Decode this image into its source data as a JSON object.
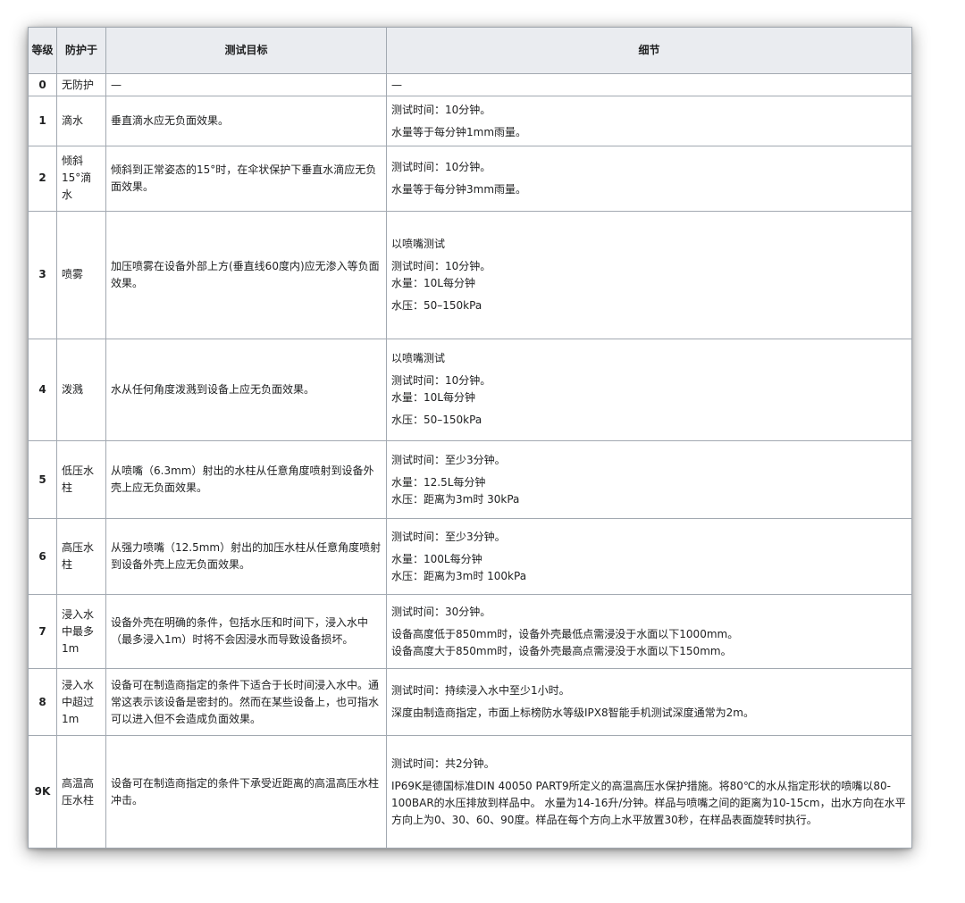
{
  "headers": {
    "level": "等级",
    "protect_against": "防护于",
    "test_goal": "测试目标",
    "details": "细节"
  },
  "rows": [
    {
      "level": "0",
      "protect": "无防护",
      "goal": "—",
      "details": [
        "—"
      ]
    },
    {
      "level": "1",
      "protect": "滴水",
      "goal": "垂直滴水应无负面效果。",
      "details": [
        "测试时间：10分钟。",
        "水量等于每分钟1mm雨量。"
      ]
    },
    {
      "level": "2",
      "protect": "倾斜15°滴水",
      "goal": "倾斜到正常姿态的15°时，在伞状保护下垂直水滴应无负面效果。",
      "details": [
        "测试时间：10分钟。",
        "水量等于每分钟3mm雨量。"
      ]
    },
    {
      "level": "3",
      "protect": "喷雾",
      "goal": "加压喷雾在设备外部上方(垂直线60度内)应无渗入等负面效果。",
      "details": [
        "以喷嘴测试",
        "测试时间：10分钟。",
        "水量：10L每分钟",
        "水压：50–150kPa"
      ]
    },
    {
      "level": "4",
      "protect": "泼溅",
      "goal": "水从任何角度泼溅到设备上应无负面效果。",
      "details": [
        "以喷嘴测试",
        "测试时间：10分钟。",
        "水量：10L每分钟",
        "水压：50–150kPa"
      ]
    },
    {
      "level": "5",
      "protect": "低压水柱",
      "goal": "从喷嘴（6.3mm）射出的水柱从任意角度喷射到设备外壳上应无负面效果。",
      "details": [
        "测试时间：至少3分钟。",
        "水量：12.5L每分钟",
        "水压：距离为3m时 30kPa"
      ]
    },
    {
      "level": "6",
      "protect": "高压水柱",
      "goal": "从强力喷嘴（12.5mm）射出的加压水柱从任意角度喷射到设备外壳上应无负面效果。",
      "details": [
        "测试时间：至少3分钟。",
        "水量：100L每分钟",
        "水压：距离为3m时 100kPa"
      ]
    },
    {
      "level": "7",
      "protect": "浸入水中最多1m",
      "goal": "设备外壳在明确的条件，包括水压和时间下，浸入水中（最多浸入1m）时将不会因浸水而导致设备损坏。",
      "details": [
        "测试时间：30分钟。",
        "设备高度低于850mm时，设备外壳最低点需浸没于水面以下1000mm。",
        "设备高度大于850mm时，设备外壳最高点需浸没于水面以下150mm。"
      ]
    },
    {
      "level": "8",
      "protect": "浸入水中超过1m",
      "goal": "设备可在制造商指定的条件下适合于长时间浸入水中。通常这表示该设备是密封的。然而在某些设备上，也可指水可以进入但不会造成负面效果。",
      "details": [
        "测试时间：持续浸入水中至少1小时。",
        "深度由制造商指定，市面上标榜防水等级IPX8智能手机测试深度通常为2m。"
      ]
    },
    {
      "level": "9K",
      "protect": "高温高压水柱",
      "goal": "设备可在制造商指定的条件下承受近距离的高温高压水柱冲击。",
      "details": [
        "测试时间：共2分钟。",
        "IP69K是德国标准DIN 40050 PART9所定义的高温高压水保护措施。将80℃的水从指定形状的喷嘴以80-100BAR的水压排放到样品中。 水量为14-16升/分钟。样品与喷嘴之间的距离为10-15cm，出水方向在水平方向上为0、30、60、90度。样品在每个方向上水平放置30秒，在样品表面旋转时执行。"
      ]
    }
  ]
}
